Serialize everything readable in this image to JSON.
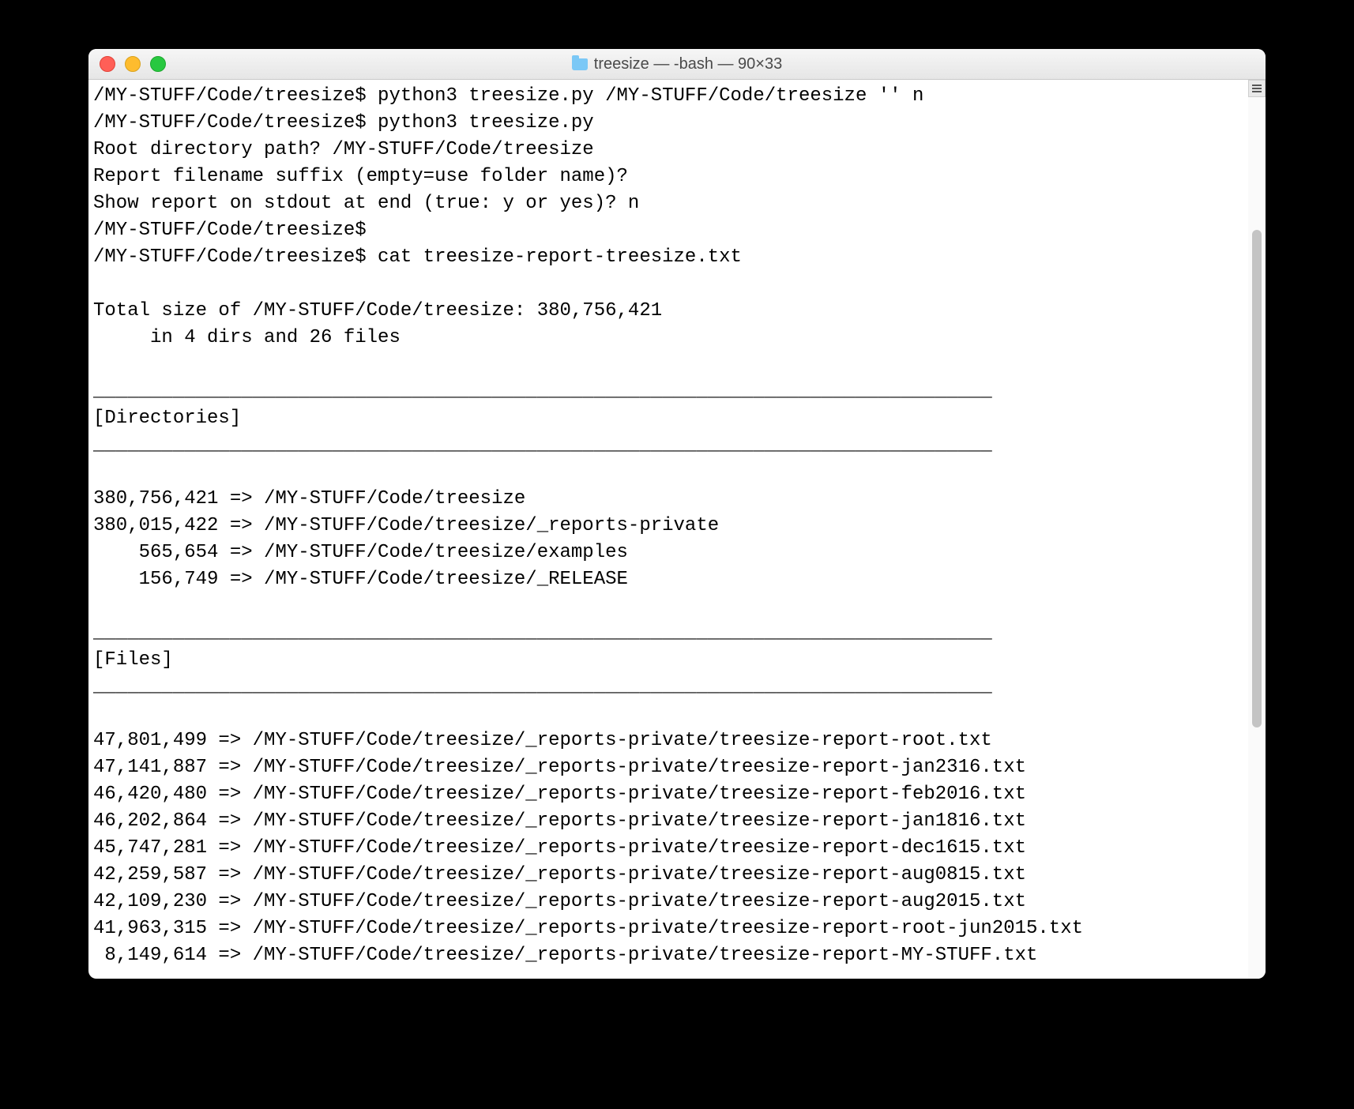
{
  "window": {
    "title": "treesize — -bash — 90×33"
  },
  "session": {
    "prompt": "/MY-STUFF/Code/treesize$",
    "cmd1": "python3 treesize.py /MY-STUFF/Code/treesize '' n",
    "cmd2": "python3 treesize.py",
    "q1": "Root directory path? /MY-STUFF/Code/treesize",
    "q2": "Report filename suffix (empty=use folder name)?",
    "q3": "Show report on stdout at end (true: y or yes)? n",
    "cmd3": "cat treesize-report-treesize.txt"
  },
  "report": {
    "total_line": "Total size of /MY-STUFF/Code/treesize: 380,756,421",
    "count_line": "     in 4 dirs and 26 files",
    "sep": "_______________________________________________________________________________",
    "dir_header": "[Directories]",
    "files_header": "[Files]",
    "dirs": [
      {
        "size": "380,756,421",
        "path": "/MY-STUFF/Code/treesize"
      },
      {
        "size": "380,015,422",
        "path": "/MY-STUFF/Code/treesize/_reports-private"
      },
      {
        "size": "    565,654",
        "path": "/MY-STUFF/Code/treesize/examples"
      },
      {
        "size": "    156,749",
        "path": "/MY-STUFF/Code/treesize/_RELEASE"
      }
    ],
    "files": [
      {
        "size": "47,801,499",
        "path": "/MY-STUFF/Code/treesize/_reports-private/treesize-report-root.txt"
      },
      {
        "size": "47,141,887",
        "path": "/MY-STUFF/Code/treesize/_reports-private/treesize-report-jan2316.txt"
      },
      {
        "size": "46,420,480",
        "path": "/MY-STUFF/Code/treesize/_reports-private/treesize-report-feb2016.txt"
      },
      {
        "size": "46,202,864",
        "path": "/MY-STUFF/Code/treesize/_reports-private/treesize-report-jan1816.txt"
      },
      {
        "size": "45,747,281",
        "path": "/MY-STUFF/Code/treesize/_reports-private/treesize-report-dec1615.txt"
      },
      {
        "size": "42,259,587",
        "path": "/MY-STUFF/Code/treesize/_reports-private/treesize-report-aug0815.txt"
      },
      {
        "size": "42,109,230",
        "path": "/MY-STUFF/Code/treesize/_reports-private/treesize-report-aug2015.txt"
      },
      {
        "size": "41,963,315",
        "path": "/MY-STUFF/Code/treesize/_reports-private/treesize-report-root-jun2015.txt"
      },
      {
        "size": " 8,149,614",
        "path": "/MY-STUFF/Code/treesize/_reports-private/treesize-report-MY-STUFF.txt"
      }
    ]
  }
}
